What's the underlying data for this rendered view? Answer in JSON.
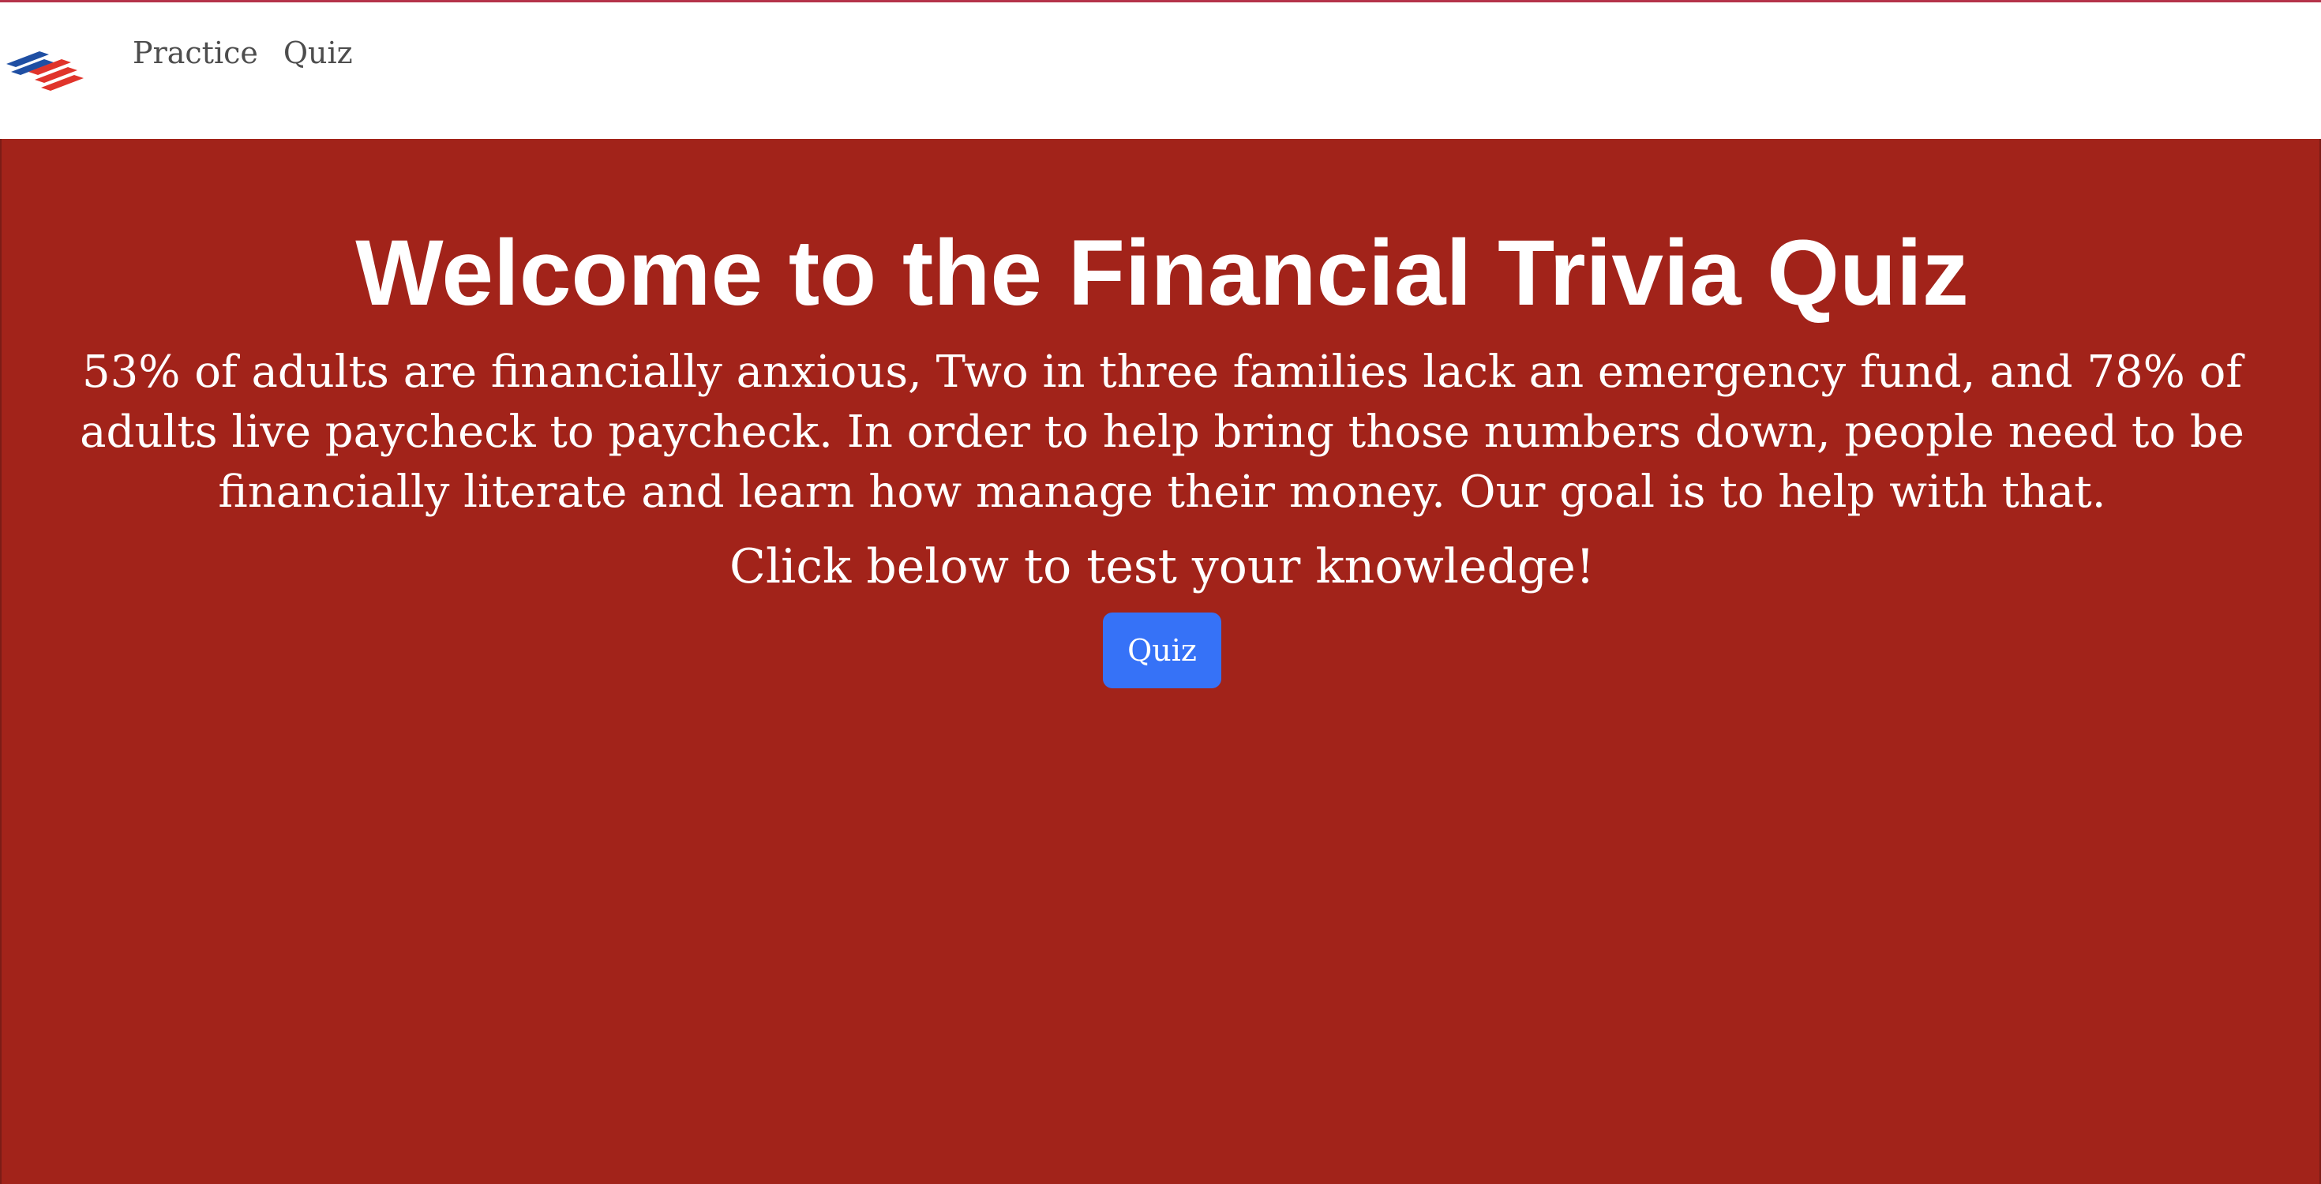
{
  "nav": {
    "logo_icon": "bank-flag-logo-icon",
    "links": [
      {
        "label": "Practice"
      },
      {
        "label": "Quiz"
      }
    ]
  },
  "hero": {
    "title": "Welcome to the Financial Trivia Quiz",
    "lead": "53% of adults are financially anxious, Two in three families lack an emergency fund, and 78% of adults live paycheck to paycheck. In order to help bring those numbers down, people need to be financially literate and learn how manage their money. Our goal is to help with that.",
    "cta_text": "Click below to test your knowledge!",
    "button_label": "Quiz"
  },
  "colors": {
    "hero_background": "#a2231a",
    "button_background": "#3672f7",
    "top_border": "#b5334a",
    "logo_blue": "#1f4fa3",
    "logo_red": "#e0342b"
  }
}
